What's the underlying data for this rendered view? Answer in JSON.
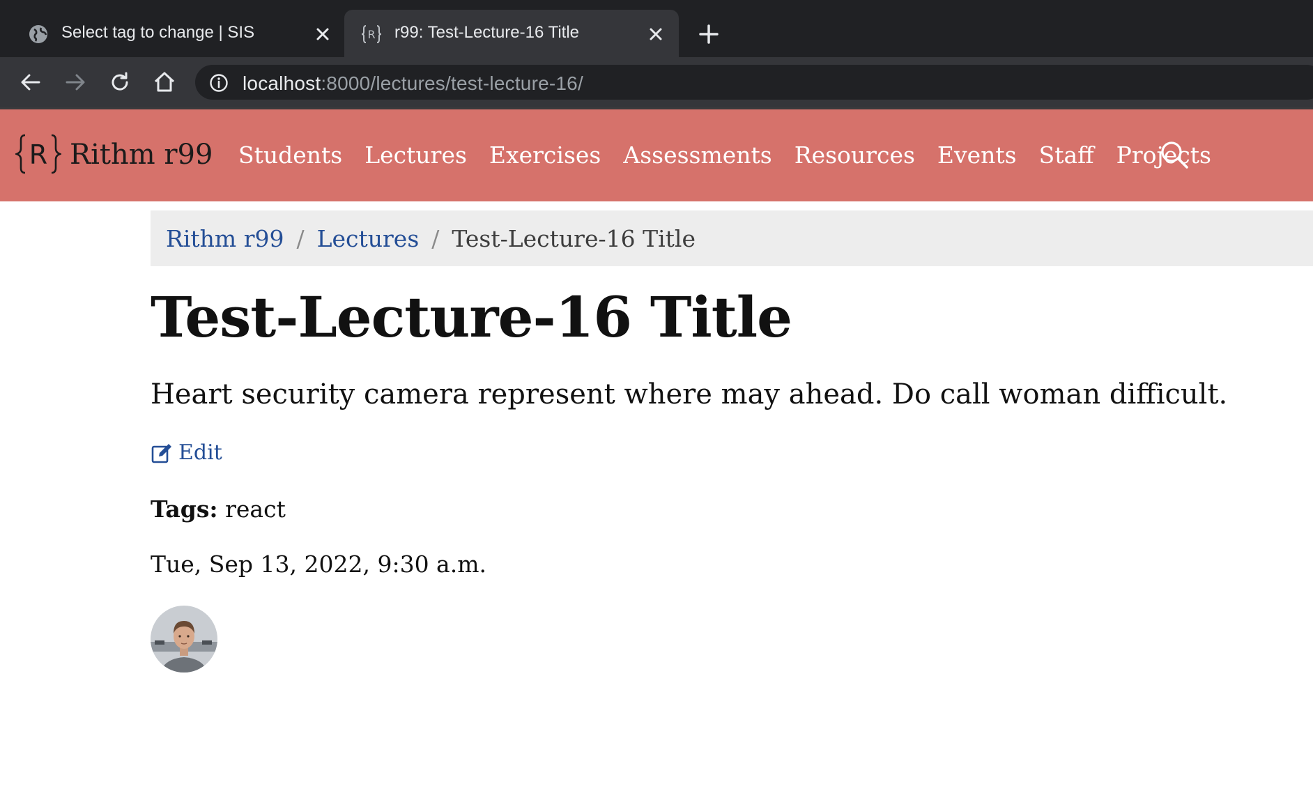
{
  "browser": {
    "tabs": [
      {
        "title": "Select tag to change | SIS",
        "icon": "globe-icon",
        "active": false
      },
      {
        "title": "r99: Test-Lecture-16 Title",
        "icon": "rithm-logo-icon",
        "active": true
      }
    ],
    "url": {
      "host": "localhost",
      "rest": ":8000/lectures/test-lecture-16/"
    }
  },
  "navbar": {
    "brand": "Rithm r99",
    "logo_letter": "R",
    "items": [
      "Students",
      "Lectures",
      "Exercises",
      "Assessments",
      "Resources",
      "Events",
      "Staff",
      "Projects"
    ],
    "bg_color": "#d6726b"
  },
  "breadcrumb": {
    "items": [
      "Rithm r99",
      "Lectures"
    ],
    "current": "Test-Lecture-16 Title",
    "separator": "/"
  },
  "lecture": {
    "title": "Test-Lecture-16 Title",
    "description": "Heart security camera represent where may ahead. Do call woman difficult.",
    "edit_label": "Edit",
    "tags_label": "Tags:",
    "tags": "react",
    "date": "Tue, Sep 13, 2022, 9:30 a.m."
  },
  "colors": {
    "link": "#244e96",
    "chrome_dark": "#202124",
    "chrome_mid": "#35363a"
  }
}
